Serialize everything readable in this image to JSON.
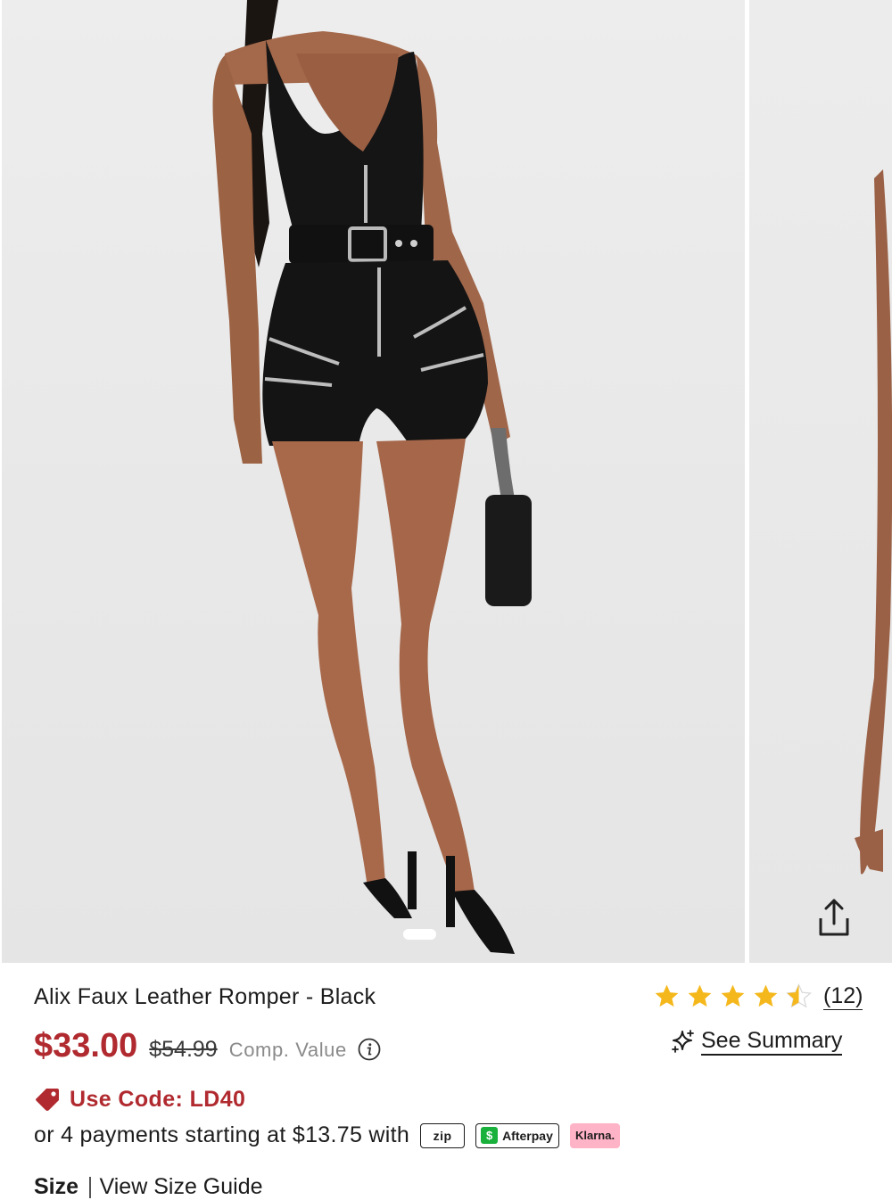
{
  "gallery": {
    "main_image_alt": "",
    "next_image_alt": "",
    "share_icon": "share-icon",
    "current_slide": 1
  },
  "product": {
    "title": "Alix Faux Leather Romper - Black",
    "rating": 4.5,
    "rating_max": 5,
    "review_count": "(12)",
    "price": "$33.00",
    "original_price": "$54.99",
    "comp_value_label": "Comp. Value",
    "see_summary_label": "See Summary",
    "promo_code_text": "Use Code: LD40",
    "installments_text": "or 4 payments starting at $13.75 with",
    "payment_badges": {
      "zip": "zip",
      "afterpay": "Afterpay",
      "afterpay_symbol": "$",
      "klarna": "Klarna."
    },
    "size_label": "Size",
    "size_guide_label": "View Size Guide"
  },
  "colors": {
    "price_red": "#b02a2f",
    "star_gold": "#f5b81c",
    "afterpay_green": "#19b03b",
    "klarna_pink": "#ffb3c7"
  }
}
